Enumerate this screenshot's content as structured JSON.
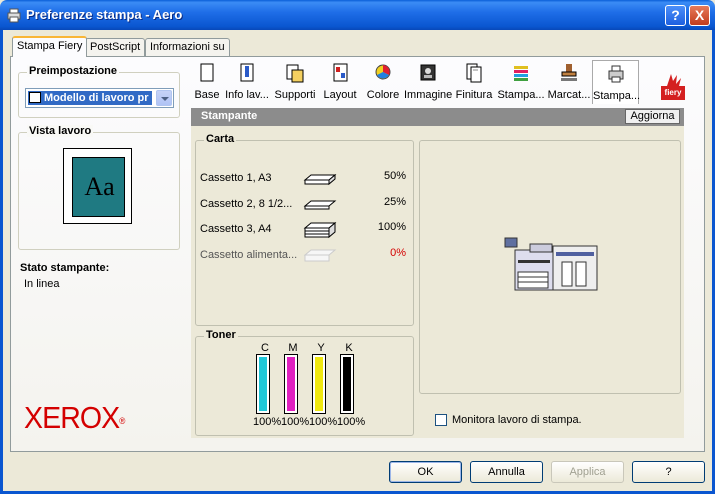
{
  "window": {
    "title": "Preferenze stampa  - Aero",
    "help_button": "?",
    "close_button": "X"
  },
  "tabs": [
    {
      "label": "Stampa Fiery",
      "active": true
    },
    {
      "label": "PostScript",
      "active": false
    },
    {
      "label": "Informazioni su",
      "active": false
    }
  ],
  "left_panel": {
    "preset_label": "Preimpostazione",
    "preset_value": "Modello di lavoro pr",
    "job_view_label": "Vista lavoro",
    "preview_text": "Aa",
    "printer_status_label": "Stato stampante:",
    "printer_status_value": "In linea",
    "logo_text": "XEROX"
  },
  "toolbar": [
    {
      "label": "Base",
      "icon": "page-icon"
    },
    {
      "label": "Info lav...",
      "icon": "info-icon"
    },
    {
      "label": "Supporti",
      "icon": "media-icon"
    },
    {
      "label": "Layout",
      "icon": "layout-icon"
    },
    {
      "label": "Colore",
      "icon": "color-icon"
    },
    {
      "label": "Immagine",
      "icon": "image-icon"
    },
    {
      "label": "Finitura",
      "icon": "finishing-icon"
    },
    {
      "label": "Stampa...",
      "icon": "stack-icon"
    },
    {
      "label": "Marcat...",
      "icon": "stamp-icon"
    },
    {
      "label": "Stampa...",
      "icon": "printer-icon",
      "active": true
    }
  ],
  "fiery_logo_text": "fiery",
  "section": {
    "title": "Stampante",
    "refresh_button": "Aggiorna"
  },
  "paper": {
    "label": "Carta",
    "trays": [
      {
        "name": "Cassetto 1, A3",
        "percent": "50%",
        "low": false
      },
      {
        "name": "Cassetto 2, 8 1/2...",
        "percent": "25%",
        "low": false
      },
      {
        "name": "Cassetto 3, A4",
        "percent": "100%",
        "low": false
      },
      {
        "name": "Cassetto alimenta...",
        "percent": "0%",
        "low": true
      }
    ]
  },
  "toner": {
    "label": "Toner",
    "cartridges": [
      {
        "label": "C",
        "percent": "100%",
        "level": 1.0,
        "color": "#20c8d8"
      },
      {
        "label": "M",
        "percent": "100%",
        "level": 1.0,
        "color": "#e020c0"
      },
      {
        "label": "Y",
        "percent": "100%",
        "level": 1.0,
        "color": "#f0e810"
      },
      {
        "label": "K",
        "percent": "100%",
        "level": 1.0,
        "color": "#000000"
      }
    ]
  },
  "monitor_checkbox": {
    "label": "Monitora lavoro di stampa.",
    "checked": false
  },
  "buttons": {
    "ok": "OK",
    "cancel": "Annulla",
    "apply": "Applica",
    "help": "?"
  },
  "colors": {
    "low_level": "#d40000",
    "accent": "#0a56d0"
  }
}
